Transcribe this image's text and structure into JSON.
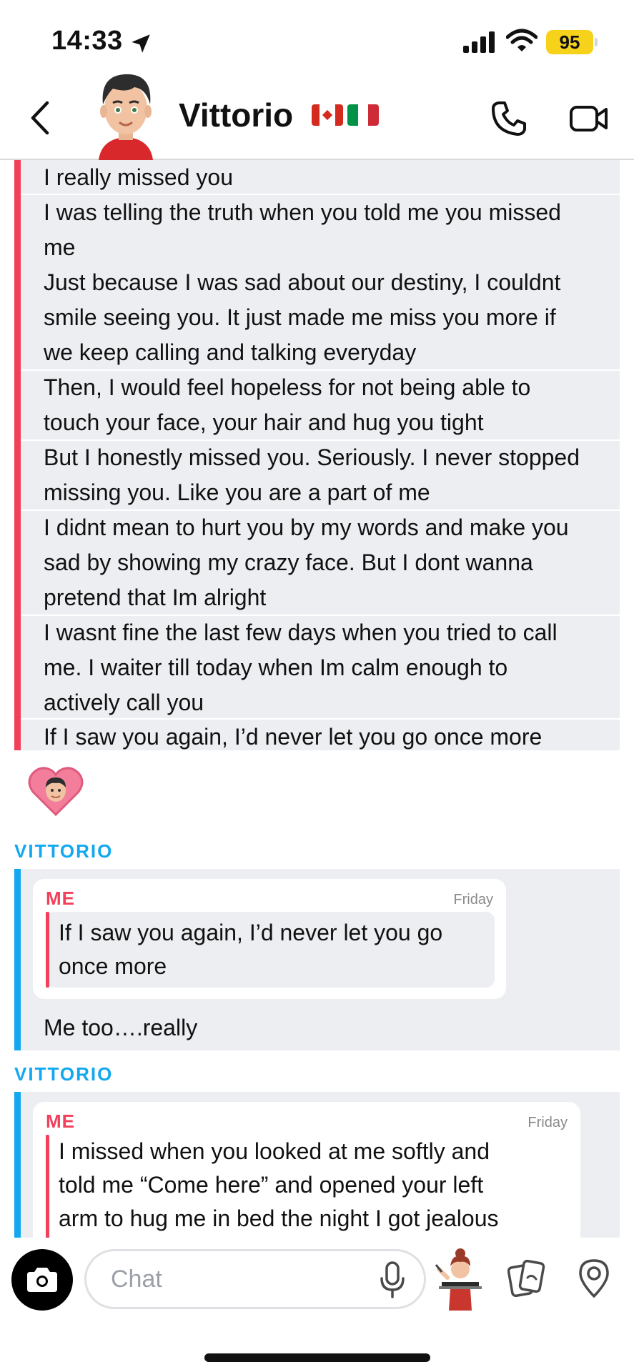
{
  "status_bar": {
    "time": "14:33",
    "battery": "95",
    "icons": [
      "location-arrow-icon",
      "signal-icon",
      "wifi-icon",
      "battery-icon"
    ],
    "battery_color": "#f7d21a"
  },
  "header": {
    "contact_name": "Vittorio",
    "flags": [
      "canada-flag",
      "italy-flag"
    ],
    "icons": [
      "back-icon",
      "phone-icon",
      "video-icon"
    ]
  },
  "chat": {
    "first_block": {
      "lines": [
        "I really missed you",
        "I was telling the truth when you told me you missed",
        "me",
        "Just because I was sad about our destiny, I couldnt",
        "smile seeing you. It just made me miss you more if",
        "we keep calling and talking everyday",
        "Then, I would feel hopeless for not being able to",
        "touch your face, your hair and hug you tight",
        "But I honestly missed you. Seriously. I never stopped",
        "missing you. Like you are a part of me",
        "I didnt mean to hurt you by my words and make you",
        "sad by showing my crazy face. But I dont wanna",
        "pretend that Im alright",
        "I wasnt fine the last few days when you tried to call",
        "me. I waiter till today when Im calm enough to",
        "actively call you",
        "If I saw you again, I’d never let you go once more"
      ]
    },
    "reaction": "heart-bitmoji-icon",
    "reply_1": {
      "sender": "VITTORIO",
      "quote_sender": "ME",
      "quote_day": "Friday",
      "quote_lines": [
        "If I saw you again, I’d never let you go",
        "once more"
      ],
      "text": "Me too….really"
    },
    "reply_2": {
      "sender": "VITTORIO",
      "quote_sender": "ME",
      "quote_day": "Friday",
      "quote_lines": [
        "I missed when you looked at me softly and",
        "told me “Come here” and opened your left",
        "arm to hug me in bed the night I got jealous"
      ]
    },
    "colors": {
      "me": "#f2405a",
      "them": "#12a8ef",
      "bubble_bg": "#eceef1"
    }
  },
  "bottom_bar": {
    "placeholder": "Chat",
    "icons": [
      "camera-icon",
      "mic-icon",
      "bitmoji-icon",
      "cards-icon",
      "map-pin-icon"
    ]
  }
}
